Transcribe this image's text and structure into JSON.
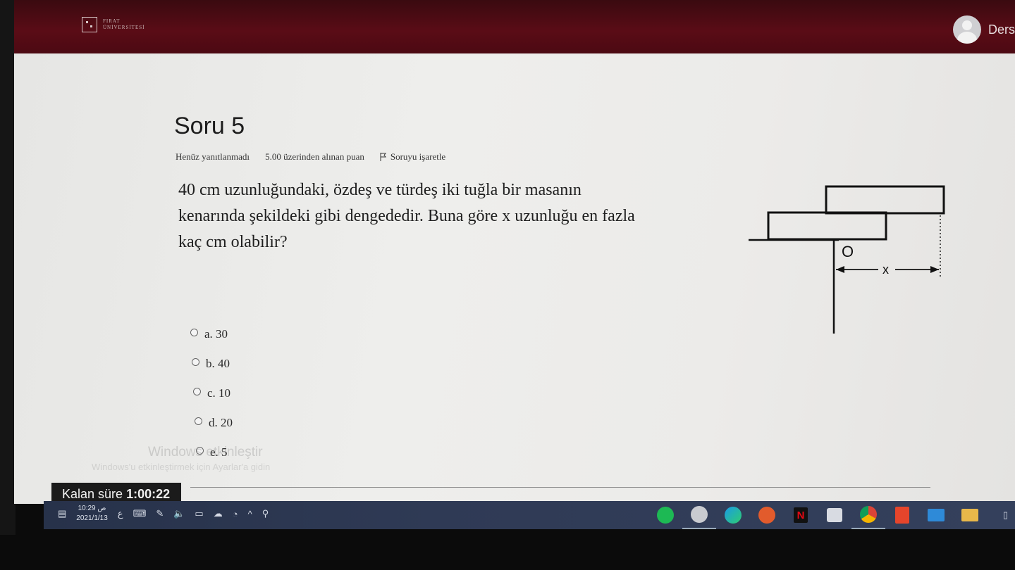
{
  "header": {
    "university_logo_text": "FIRAT ÜNİVERSİTESİ",
    "user_name": "Ders"
  },
  "question": {
    "title": "Soru 5",
    "status": "Henüz yanıtlanmadı",
    "points": "5.00 üzerinden alınan puan",
    "flag_label": "Soruyu işaretle",
    "text_lines": [
      "40 cm uzunluğundaki, özdeş ve türdeş iki tuğla bir masanın",
      "kenarında şekildeki gibi dengededir. Buna göre x uzunluğu en fazla",
      "kaç cm olabilir?"
    ],
    "figure": {
      "point_label": "O",
      "length_label": "x"
    },
    "options": [
      {
        "label": "a. 30"
      },
      {
        "label": "b. 40"
      },
      {
        "label": "c. 10"
      },
      {
        "label": "d. 20"
      },
      {
        "label": "e. 5"
      }
    ]
  },
  "watermark": {
    "line1": "Windows etkinleştir",
    "line2": "Windows'u etkinleştirmek için Ayarlar'a gidin"
  },
  "timer": {
    "label": "Kalan süre",
    "value": "1:00:22"
  },
  "taskbar": {
    "time": "10:29 ص",
    "date": "2021/1/13",
    "lang": "ع",
    "apps": [
      "spotify-icon",
      "app-circle-icon",
      "edge-icon",
      "media-player-icon",
      "netflix-icon",
      "store-icon",
      "chrome-icon",
      "office-icon",
      "mail-icon",
      "folder-icon"
    ]
  }
}
